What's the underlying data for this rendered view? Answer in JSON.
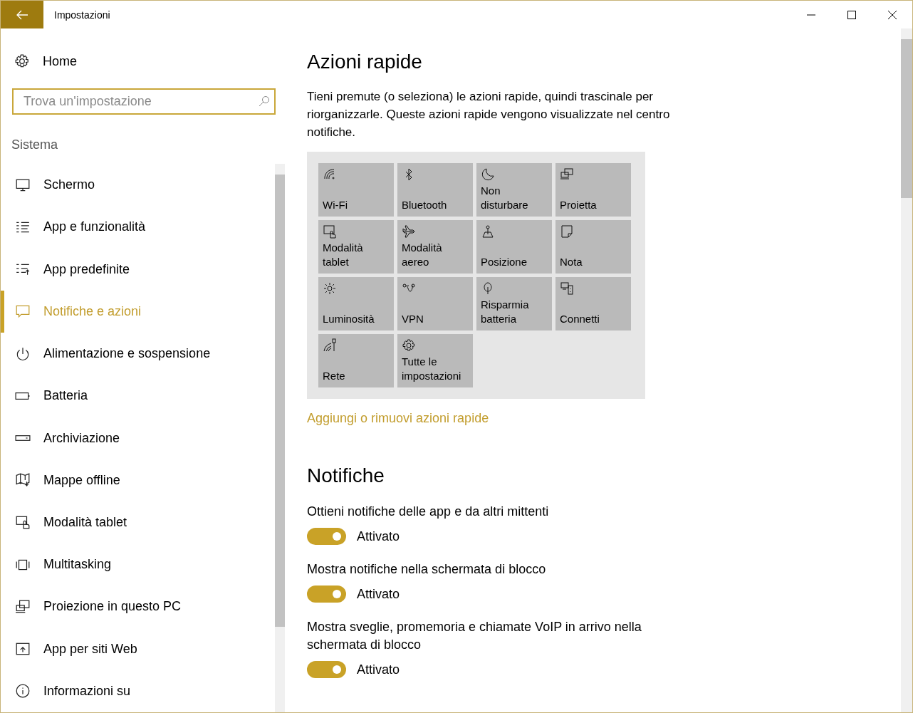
{
  "window": {
    "title": "Impostazioni"
  },
  "sidebar": {
    "home": "Home",
    "search": {
      "placeholder": "Trova un'impostazione"
    },
    "section": "Sistema",
    "items": [
      {
        "label": "Schermo",
        "selected": false
      },
      {
        "label": "App e funzionalità",
        "selected": false
      },
      {
        "label": "App predefinite",
        "selected": false
      },
      {
        "label": "Notifiche e azioni",
        "selected": true
      },
      {
        "label": "Alimentazione e sospensione",
        "selected": false
      },
      {
        "label": "Batteria",
        "selected": false
      },
      {
        "label": "Archiviazione",
        "selected": false
      },
      {
        "label": "Mappe offline",
        "selected": false
      },
      {
        "label": "Modalità tablet",
        "selected": false
      },
      {
        "label": "Multitasking",
        "selected": false
      },
      {
        "label": "Proiezione in questo PC",
        "selected": false
      },
      {
        "label": "App per siti Web",
        "selected": false
      },
      {
        "label": "Informazioni su",
        "selected": false
      }
    ]
  },
  "quick_actions": {
    "title": "Azioni rapide",
    "description": "Tieni premute (o seleziona) le azioni rapide, quindi trascinale per riorganizzarle. Queste azioni rapide vengono visualizzate nel centro notifiche.",
    "tiles": [
      "Wi-Fi",
      "Bluetooth",
      "Non disturbare",
      "Proietta",
      "Modalità tablet",
      "Modalità aereo",
      "Posizione",
      "Nota",
      "Luminosità",
      "VPN",
      "Risparmia batteria",
      "Connetti",
      "Rete",
      "Tutte le impostazioni"
    ],
    "link": "Aggiungi o rimuovi azioni rapide"
  },
  "notifications": {
    "title": "Notifiche",
    "settings": [
      {
        "label": "Ottieni notifiche delle app e da altri mittenti",
        "on": true,
        "state": "Attivato"
      },
      {
        "label": "Mostra notifiche nella schermata di blocco",
        "on": true,
        "state": "Attivato"
      },
      {
        "label": "Mostra sveglie, promemoria e chiamate VoIP in arrivo nella schermata di blocco",
        "on": true,
        "state": "Attivato"
      }
    ]
  }
}
